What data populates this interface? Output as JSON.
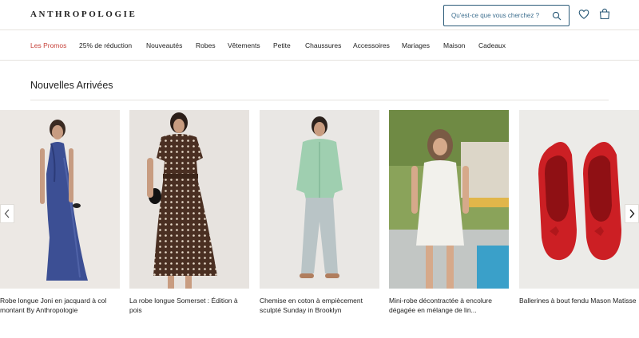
{
  "header": {
    "logo": "ANTHROPOLOGIE",
    "search_placeholder": "Qu'est-ce que vous cherchez ?"
  },
  "nav": {
    "items": [
      "Les Promos",
      "25% de réduction",
      "Nouveautés",
      "Robes",
      "Vêtements",
      "Petite",
      "Chaussures",
      "Accessoires",
      "Mariages",
      "Maison",
      "Cadeaux"
    ]
  },
  "section": {
    "title": "Nouvelles Arrivées"
  },
  "products": [
    {
      "title": "Robe longue Joni en jacquard à col montant By Anthropologie"
    },
    {
      "title": "La robe longue Somerset : Édition à pois"
    },
    {
      "title": "Chemise en coton à empiècement sculpté Sunday in Brooklyn"
    },
    {
      "title": "Mini-robe décontractée à encolure dégagée en mélange de lin..."
    },
    {
      "title": "Ballerines à bout fendu Mason Matisse"
    }
  ],
  "colors": {
    "promo": "#c6423a",
    "search_border": "#2a5a78",
    "icon": "#2a5a78"
  }
}
